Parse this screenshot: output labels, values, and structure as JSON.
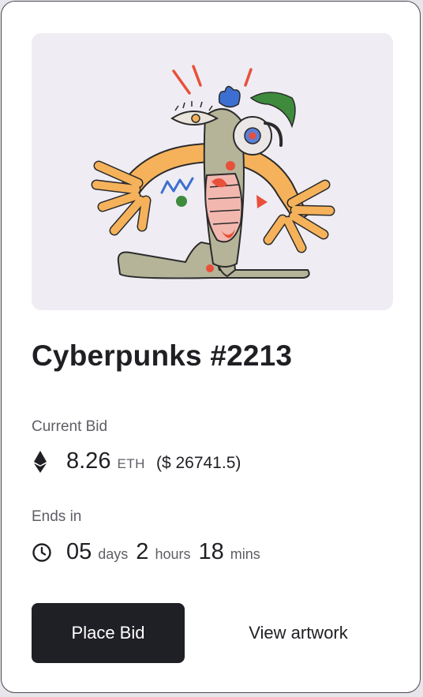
{
  "card": {
    "artwork_alt": "Cyberpunks #2213 artwork",
    "title": "Cyberpunks #2213",
    "current_bid": {
      "label": "Current Bid",
      "amount": "8.26",
      "currency": "ETH",
      "usd_value": "($ 26741.5)"
    },
    "ends_in": {
      "label": "Ends in",
      "days_value": "05",
      "days_unit": "days",
      "hours_value": "2",
      "hours_unit": "hours",
      "mins_value": "18",
      "mins_unit": "mins"
    },
    "actions": {
      "place_bid_label": "Place Bid",
      "view_artwork_label": "View artwork"
    }
  },
  "icons": {
    "currency": "ethereum-icon",
    "timer": "clock-icon"
  },
  "colors": {
    "primary_button": "#1f1f26",
    "art_background": "#efedf3",
    "muted_text": "#5e5e66"
  }
}
